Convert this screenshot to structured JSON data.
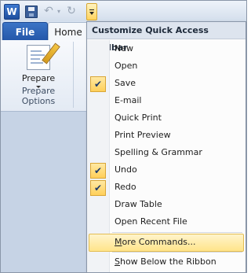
{
  "qat": {
    "app_icon_letter": "W",
    "icons": [
      "word-icon",
      "save-icon",
      "undo-icon",
      "redo-icon",
      "customize-dropdown-icon"
    ]
  },
  "ribbon": {
    "tabs": [
      {
        "label": "File"
      },
      {
        "label": "Home"
      }
    ],
    "prepare": {
      "button_label": "Prepare",
      "group_label": "Prepare Options"
    }
  },
  "menu": {
    "header": "Customize Quick Access Toolbar",
    "items": [
      {
        "label": "New",
        "checked": false
      },
      {
        "label": "Open",
        "checked": false
      },
      {
        "label": "Save",
        "checked": true
      },
      {
        "label": "E-mail",
        "checked": false
      },
      {
        "label": "Quick Print",
        "checked": false
      },
      {
        "label": "Print Preview",
        "checked": false
      },
      {
        "label": "Spelling & Grammar",
        "checked": false
      },
      {
        "label": "Undo",
        "checked": true
      },
      {
        "label": "Redo",
        "checked": true
      },
      {
        "label": "Draw Table",
        "checked": false
      },
      {
        "label": "Open Recent File",
        "checked": false
      }
    ],
    "more_commands": {
      "underline_char": "M",
      "rest": "ore Commands..."
    },
    "show_below": {
      "underline_char": "S",
      "rest": "how Below the Ribbon"
    }
  },
  "colors": {
    "accent_file_tab": "#2456a8",
    "hover_highlight": "#ffe48a",
    "check_bg": "#ffcf5a"
  }
}
